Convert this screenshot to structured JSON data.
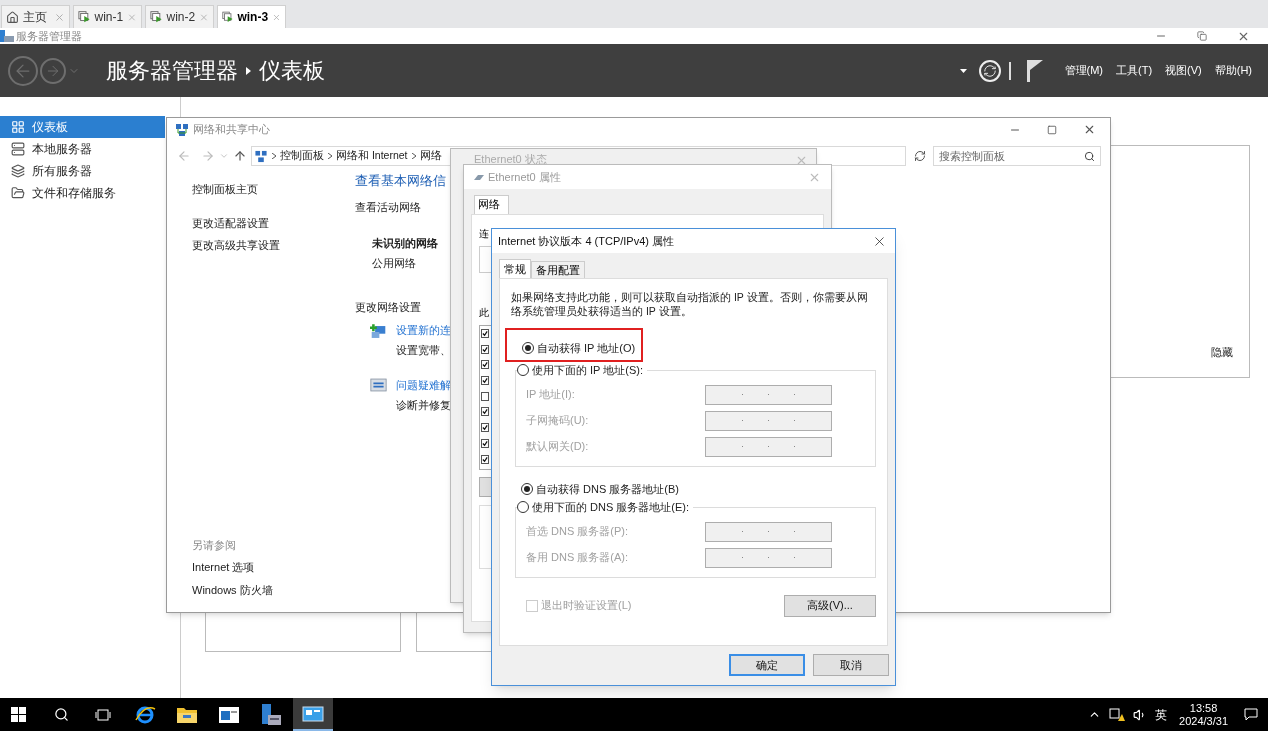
{
  "tabs": [
    {
      "label": "主页",
      "kind": "home",
      "selected": false
    },
    {
      "label": "win-1",
      "kind": "vm",
      "selected": false
    },
    {
      "label": "win-2",
      "kind": "vm",
      "selected": false
    },
    {
      "label": "win-3",
      "kind": "vm",
      "selected": true
    }
  ],
  "app": {
    "title": "服务器管理器",
    "breadcrumb": [
      "服务器管理器",
      "仪表板"
    ],
    "menus": [
      "管理(M)",
      "工具(T)",
      "视图(V)",
      "帮助(H)"
    ]
  },
  "sidebar": {
    "items": [
      {
        "label": "仪表板",
        "kind": "dashboard",
        "selected": true
      },
      {
        "label": "本地服务器",
        "kind": "server",
        "selected": false
      },
      {
        "label": "所有服务器",
        "kind": "servers",
        "selected": false
      },
      {
        "label": "文件和存储服务",
        "kind": "storage",
        "selected": false
      }
    ]
  },
  "dashboard": {
    "hide_label": "隐藏"
  },
  "network_center": {
    "title": "网络和共享中心",
    "address": [
      "控制面板",
      "网络和 Internet",
      "网络"
    ],
    "search": {
      "placeholder": "搜索控制面板"
    },
    "tasks": [
      "控制面板主页",
      "更改适配器设置",
      "更改高级共享设置"
    ],
    "see_also": {
      "heading": "另请参阅",
      "links": [
        "Internet 选项",
        "Windows 防火墙"
      ]
    },
    "heading": "查看基本网络信",
    "active_networks": {
      "heading": "查看活动网络",
      "name": "未识别的网络",
      "category": "公用网络"
    },
    "change_settings": {
      "heading": "更改网络设置",
      "items": [
        {
          "kind": "new_connection",
          "link": "设置新的连",
          "description": "设置宽带、"
        },
        {
          "kind": "troubleshoot",
          "link": "问题疑难解",
          "description": "诊断并修复"
        }
      ]
    }
  },
  "status_window": {
    "title": "Ethernet0 状态"
  },
  "properties_window": {
    "title": "Ethernet0 属性",
    "tabs": [
      {
        "label": "网络",
        "selected": true
      }
    ],
    "connect_label": "连",
    "components_label": "此",
    "components": [
      {
        "checked": true
      },
      {
        "checked": true
      },
      {
        "checked": true
      },
      {
        "checked": true
      },
      {
        "checked": false
      },
      {
        "checked": true
      },
      {
        "checked": true
      },
      {
        "checked": true
      },
      {
        "checked": true
      }
    ]
  },
  "ipv4_dialog": {
    "title": "Internet 协议版本 4 (TCP/IPv4) 属性",
    "tabs": [
      {
        "label": "常规",
        "selected": true
      },
      {
        "label": "备用配置",
        "selected": false
      }
    ],
    "description": "如果网络支持此功能，则可以获取自动指派的 IP 设置。否则，你需要从网络系统管理员处获得适当的 IP 设置。",
    "ip_options": [
      {
        "label": "自动获得 IP 地址(O)",
        "selected": true,
        "highlighted": true
      },
      {
        "label": "使用下面的 IP 地址(S):",
        "selected": false,
        "highlighted": false
      }
    ],
    "ip_fields": [
      {
        "label": "IP 地址(I):",
        "disabled": true
      },
      {
        "label": "子网掩码(U):",
        "disabled": true
      },
      {
        "label": "默认网关(D):",
        "disabled": true
      }
    ],
    "dns_options": [
      {
        "label": "自动获得 DNS 服务器地址(B)",
        "selected": true
      },
      {
        "label": "使用下面的 DNS 服务器地址(E):",
        "selected": false
      }
    ],
    "dns_fields": [
      {
        "label": "首选 DNS 服务器(P):",
        "disabled": true
      },
      {
        "label": "备用 DNS 服务器(A):",
        "disabled": true
      }
    ],
    "validate_on_exit": {
      "label": "退出时验证设置(L)",
      "checked": false,
      "disabled": true
    },
    "advanced_button": "高级(V)...",
    "buttons": [
      {
        "label": "确定",
        "kind": "default"
      },
      {
        "label": "取消",
        "kind": "normal"
      }
    ]
  },
  "taskbar": {
    "apps": [
      {
        "kind": "browser",
        "selected": false
      },
      {
        "kind": "folder",
        "selected": false
      },
      {
        "kind": "window",
        "selected": false
      },
      {
        "kind": "server",
        "selected": false
      },
      {
        "kind": "network",
        "selected": true
      }
    ],
    "ime": "英",
    "time": "13:58",
    "date": "2024/3/31"
  }
}
